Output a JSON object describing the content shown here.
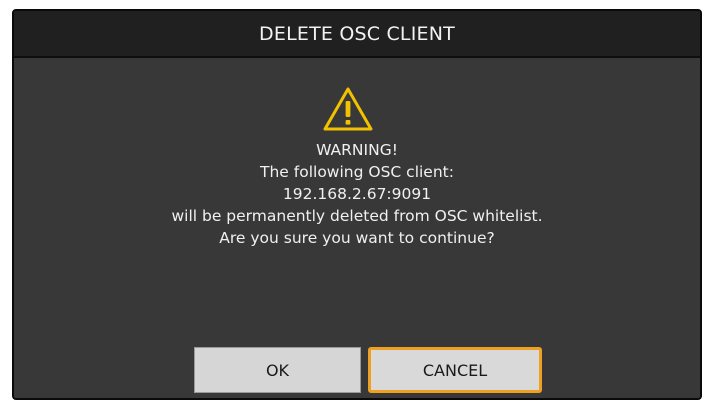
{
  "dialog": {
    "title": "DELETE OSC CLIENT",
    "icon": "warning-icon",
    "accent_color": "#f0a020",
    "message_lines": [
      "WARNING!",
      "The following OSC client:",
      "192.168.2.67:9091",
      "will be permanently deleted from OSC whitelist.",
      "Are you sure you want to continue?"
    ],
    "ok_label": "OK",
    "cancel_label": "CANCEL",
    "focused_button": "cancel"
  }
}
